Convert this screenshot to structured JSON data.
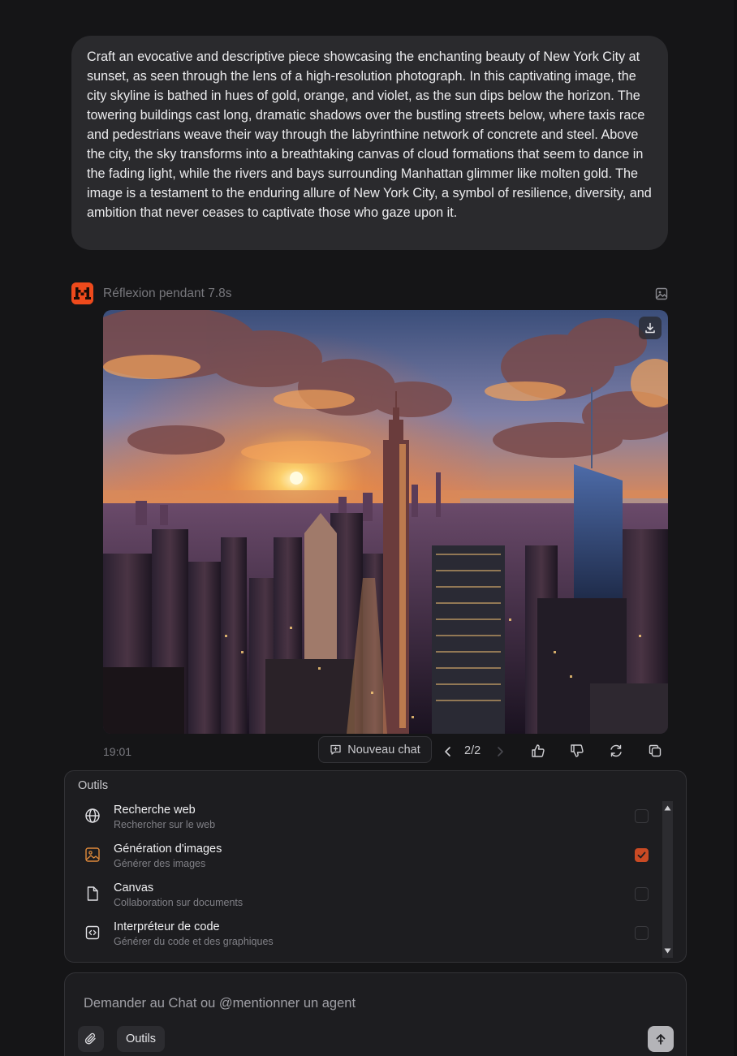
{
  "user_message": {
    "text": "Craft an evocative and descriptive piece showcasing the enchanting beauty of New York City at sunset, as seen through the lens of a high-resolution photograph. In this captivating image, the city skyline is bathed in hues of gold, orange, and violet, as the sun dips below the horizon. The towering buildings cast long, dramatic shadows over the bustling streets below, where taxis race and pedestrians weave their way through the labyrinthine network of concrete and steel. Above the city, the sky transforms into a breathtaking canvas of cloud formations that seem to dance in the fading light, while the rivers and bays surrounding Manhattan glimmer like molten gold. The image is a testament to the enduring allure of New York City, a symbol of resilience, diversity, and ambition that never ceases to captivate those who gaze upon it."
  },
  "assistant": {
    "thinking_label": "Réflexion pendant 7.8s",
    "avatar_color": "#ee4a1c"
  },
  "message_footer": {
    "time": "19:01",
    "new_chat_label": "Nouveau chat",
    "page_indicator": "2/2"
  },
  "tools_panel": {
    "title": "Outils",
    "items": [
      {
        "name": "Recherche web",
        "description": "Rechercher sur le web",
        "icon": "globe-icon",
        "checked": false
      },
      {
        "name": "Génération d'images",
        "description": "Générer des images",
        "icon": "image-icon",
        "checked": true
      },
      {
        "name": "Canvas",
        "description": "Collaboration sur documents",
        "icon": "document-icon",
        "checked": false
      },
      {
        "name": "Interpréteur de code",
        "description": "Générer du code et des graphiques",
        "icon": "code-icon",
        "checked": false
      }
    ]
  },
  "composer": {
    "placeholder": "Demander au Chat ou @mentionner un agent",
    "tools_label": "Outils"
  },
  "colors": {
    "background": "#151517",
    "bubble": "#2a2a2d",
    "accent": "#ee4a1c",
    "checkbox_on": "#c94a24"
  }
}
